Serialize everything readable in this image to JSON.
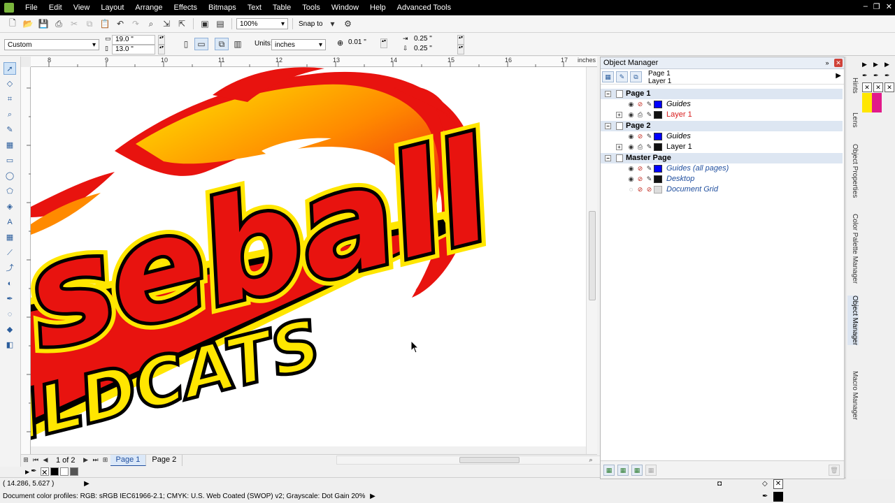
{
  "menubar": {
    "items": [
      "File",
      "Edit",
      "View",
      "Layout",
      "Arrange",
      "Effects",
      "Bitmaps",
      "Text",
      "Table",
      "Tools",
      "Window",
      "Help",
      "Advanced Tools"
    ]
  },
  "toolbar": {
    "zoom": "100%",
    "snap_to": "Snap to"
  },
  "property_bar": {
    "preset": "Custom",
    "width": "19.0 \"",
    "height": "13.0 \"",
    "units_label": "Units:",
    "units_value": "inches",
    "nudge": "0.01 \"",
    "dup_x": "0.25 \"",
    "dup_y": "0.25 \""
  },
  "ruler": {
    "h_labels": [
      "8",
      "9",
      "10",
      "11",
      "12",
      "13",
      "14",
      "15",
      "16",
      "17"
    ],
    "unit": "inches"
  },
  "page_nav": {
    "count": "1 of 2",
    "tabs": [
      "Page 1",
      "Page 2"
    ],
    "active": "Page 1"
  },
  "status": {
    "coords": "( 14.286, 5.627 )",
    "profiles": "Document color profiles: RGB: sRGB IEC61966-2.1; CMYK: U.S. Web Coated (SWOP) v2; Grayscale: Dot Gain 20%"
  },
  "object_manager": {
    "title": "Object Manager",
    "context_page": "Page 1",
    "context_layer": "Layer 1",
    "pages": [
      {
        "name": "Page 1",
        "layers": [
          {
            "name": "Guides",
            "color": "#0000ff",
            "style": "italic",
            "active": false
          },
          {
            "name": "Layer 1",
            "color": "#111111",
            "style": "red",
            "active": true
          }
        ]
      },
      {
        "name": "Page 2",
        "layers": [
          {
            "name": "Guides",
            "color": "#0000ff",
            "style": "italic",
            "active": false
          },
          {
            "name": "Layer 1",
            "color": "#111111",
            "style": "normal",
            "active": false
          }
        ]
      },
      {
        "name": "Master Page",
        "layers": [
          {
            "name": "Guides (all pages)",
            "color": "#0000ff",
            "style": "italic-blue",
            "active": false
          },
          {
            "name": "Desktop",
            "color": "#111111",
            "style": "italic-blue",
            "active": false
          },
          {
            "name": "Document Grid",
            "color": "#dddddd",
            "style": "italic-blue",
            "active": false
          }
        ]
      }
    ]
  },
  "docker_tabs": [
    "Hints",
    "Lens",
    "Object Properties",
    "Color Palette Manager",
    "Object Manager",
    "Macro Manager"
  ],
  "artwork": {
    "line1": "seball",
    "line2": "ILDCATS"
  },
  "colors": {
    "flame_red": "#e8130f",
    "flame_yellow": "#ffe600",
    "outline_black": "#000000",
    "layer_active": "#d81b1b"
  }
}
